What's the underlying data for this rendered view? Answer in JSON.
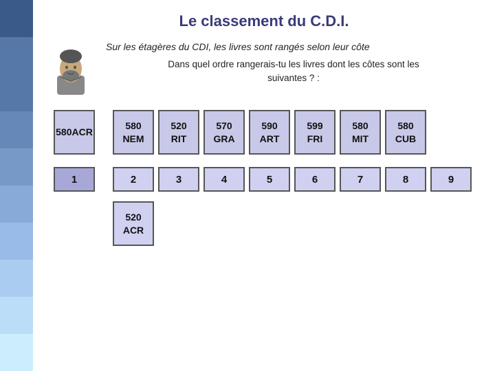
{
  "page": {
    "title": "Le classement du C.D.I.",
    "subtitle": "Sur les étagères du CDI, les livres sont rangés selon leur côte",
    "instruction": "Dans quel ordre rangerais-tu les livres dont les côtes sont les\nsuivantes ? :"
  },
  "left_bar": {
    "colors": [
      "#3a5a8a",
      "#4a6a9a",
      "#5578a8",
      "#6688b8",
      "#7799c8",
      "#88aad8",
      "#99bbe8",
      "#aaccf0",
      "#bbddf8",
      "#cceefc"
    ]
  },
  "books": [
    {
      "id": "book-first",
      "line1": "580",
      "line2": "ACR"
    },
    {
      "id": "book-nem",
      "line1": "580",
      "line2": "NEM"
    },
    {
      "id": "book-rit",
      "line1": "520",
      "line2": "RIT"
    },
    {
      "id": "book-gra",
      "line1": "570",
      "line2": "GRA"
    },
    {
      "id": "book-art",
      "line1": "590",
      "line2": "ART"
    },
    {
      "id": "book-fri",
      "line1": "599",
      "line2": "FRI"
    },
    {
      "id": "book-mit",
      "line1": "580",
      "line2": "MIT"
    },
    {
      "id": "book-cub",
      "line1": "580",
      "line2": "CUB"
    }
  ],
  "numbers": [
    {
      "id": "num-1",
      "label": "1",
      "filled": true
    },
    {
      "id": "num-2",
      "label": "2",
      "filled": false
    },
    {
      "id": "num-3",
      "label": "3",
      "filled": false
    },
    {
      "id": "num-4",
      "label": "4",
      "filled": false
    },
    {
      "id": "num-5",
      "label": "5",
      "filled": false
    },
    {
      "id": "num-6",
      "label": "6",
      "filled": false
    },
    {
      "id": "num-7",
      "label": "7",
      "filled": false
    },
    {
      "id": "num-8",
      "label": "8",
      "filled": false
    },
    {
      "id": "num-9",
      "label": "9",
      "filled": false
    }
  ],
  "answer": {
    "line1": "520",
    "line2": "ACR"
  }
}
